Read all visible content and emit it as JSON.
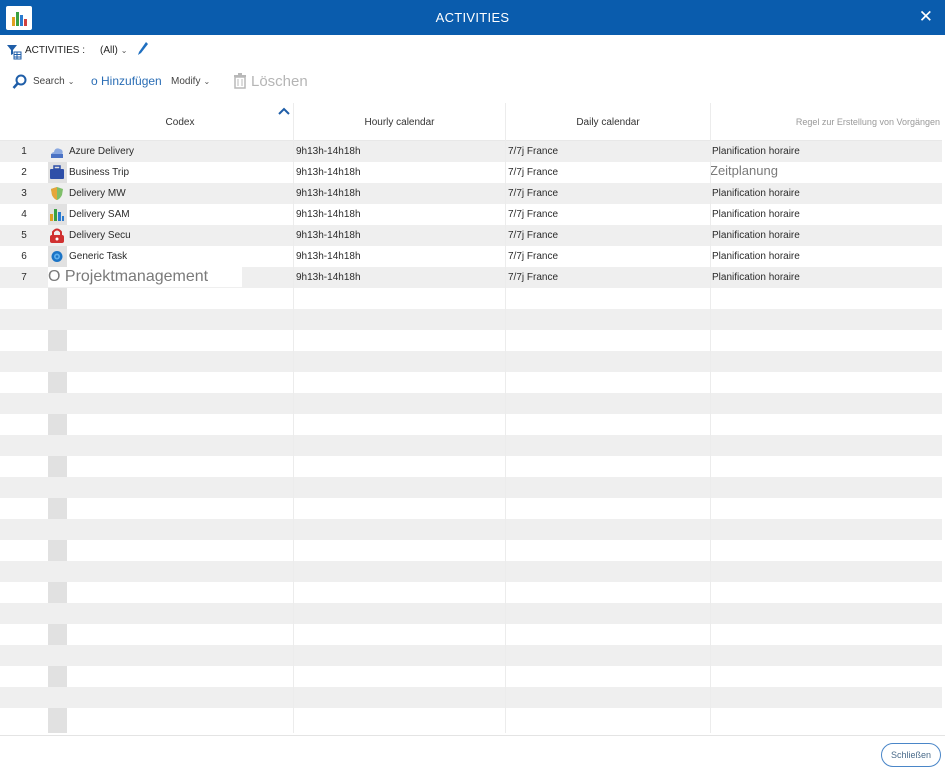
{
  "window": {
    "title": "ACTIVITIES",
    "close_glyph": "✕",
    "accent_color": "#0a5cad"
  },
  "filter": {
    "label": "ACTIVITIES :",
    "value": "(All)",
    "edit_icon": "pencil-icon"
  },
  "toolbar": {
    "search_label": "Search",
    "add_label": "o Hinzufügen",
    "modify_label": "Modify",
    "delete_label": "Löschen"
  },
  "columns": {
    "codex": "Codex",
    "hourly": "Hourly calendar",
    "daily": "Daily calendar",
    "rule": "Regel zur Erstellung von Vorgängen"
  },
  "rows": [
    {
      "num": "1",
      "icon": "azure-icon",
      "codex": "Azure Delivery",
      "hourly": "9h13h-14h18h",
      "daily": "7/7j France",
      "rule": "Planification horaire"
    },
    {
      "num": "2",
      "icon": "briefcase-icon",
      "codex": "Business Trip",
      "hourly": "9h13h-14h18h",
      "daily": "7/7j France",
      "rule": "Zeitplanung"
    },
    {
      "num": "3",
      "icon": "shield-icon",
      "codex": "Delivery MW",
      "hourly": "9h13h-14h18h",
      "daily": "7/7j France",
      "rule": "Planification horaire"
    },
    {
      "num": "4",
      "icon": "bar-chart-icon",
      "codex": "Delivery SAM",
      "hourly": "9h13h-14h18h",
      "daily": "7/7j France",
      "rule": "Planification horaire"
    },
    {
      "num": "5",
      "icon": "lock-icon",
      "codex": "Delivery Secu",
      "hourly": "9h13h-14h18h",
      "daily": "7/7j France",
      "rule": "Planification horaire"
    },
    {
      "num": "6",
      "icon": "gear-icon",
      "codex": "Generic Task",
      "hourly": "9h13h-14h18h",
      "daily": "7/7j France",
      "rule": "Planification horaire"
    },
    {
      "num": "7",
      "icon": "",
      "codex": "O Projektmanagement",
      "hourly": "9h13h-14h18h",
      "daily": "7/7j France",
      "rule": "Planification horaire"
    }
  ],
  "footer": {
    "close_label": "Schließen"
  }
}
